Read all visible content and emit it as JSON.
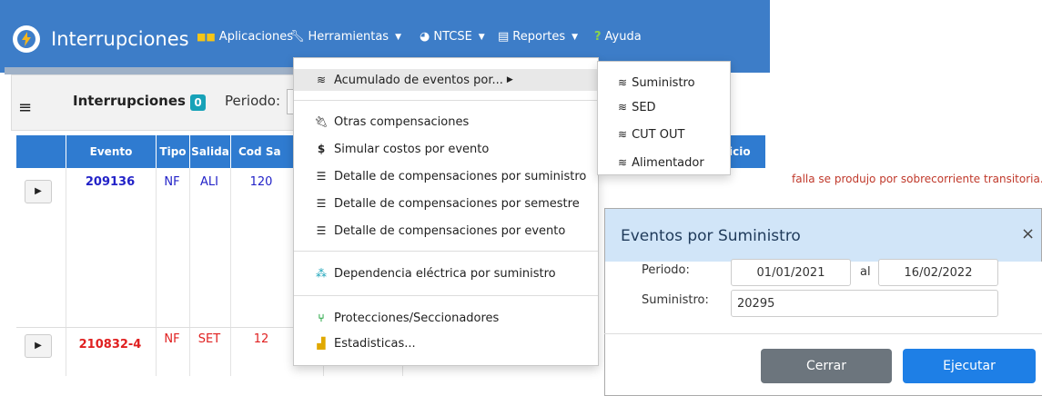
{
  "navbar": {
    "title": "Interrupciones",
    "items": [
      {
        "label": "Aplicaciones",
        "icon": "grid-icon"
      },
      {
        "label": "Herramientas",
        "icon": "wrench-icon"
      },
      {
        "label": "NTCSE",
        "icon": "dashboard-icon"
      },
      {
        "label": "Reportes",
        "icon": "table-icon"
      },
      {
        "label": "Ayuda",
        "icon": "question-icon"
      }
    ],
    "accent": "#3d7dc8"
  },
  "toolbar": {
    "title": "Interrupciones :",
    "count": "0",
    "periodo_label": "Periodo:"
  },
  "table": {
    "headers": [
      "Evento",
      "Tipo",
      "Salida",
      "Cod Sa",
      "icio"
    ],
    "rows": [
      {
        "evento": "209136",
        "tipo": "NF",
        "salida": "ALI",
        "cod": "120",
        "color": "#2323c8"
      },
      {
        "evento": "210832-4",
        "tipo": "NF",
        "salida": "SET",
        "cod": "12",
        "color": "#e02020"
      }
    ],
    "note": "falla se produjo por sobrecorriente transitoria. Se"
  },
  "dropdown": {
    "items": [
      {
        "label": "Acumulado de eventos por...",
        "icon": "layers-icon",
        "submenu": true
      },
      {
        "label": "Otras compensaciones",
        "icon": "plug-icon"
      },
      {
        "label": "Simular costos por evento",
        "icon": "dollar-icon"
      },
      {
        "label": "Detalle de compensaciones por suministro",
        "icon": "list-icon"
      },
      {
        "label": "Detalle de compensaciones por semestre",
        "icon": "list-icon"
      },
      {
        "label": "Detalle de compensaciones por evento",
        "icon": "list-icon"
      },
      {
        "label": "Dependencia eléctrica por suministro",
        "icon": "network-icon"
      },
      {
        "label": "Protecciones/Seccionadores",
        "icon": "branch-icon"
      },
      {
        "label": "Estadisticas...",
        "icon": "chart-icon"
      }
    ]
  },
  "submenu": {
    "items": [
      "Suministro",
      "SED",
      "CUT OUT",
      "Alimentador"
    ]
  },
  "modal": {
    "title": "Eventos por Suministro",
    "close": "×",
    "periodo_label": "Periodo:",
    "fecha_inicio": "01/01/2021",
    "al": "al",
    "fecha_fin": "16/02/2022",
    "suministro_label": "Suministro:",
    "suministro_value": "20295",
    "cerrar": "Cerrar",
    "ejecutar": "Ejecutar"
  }
}
